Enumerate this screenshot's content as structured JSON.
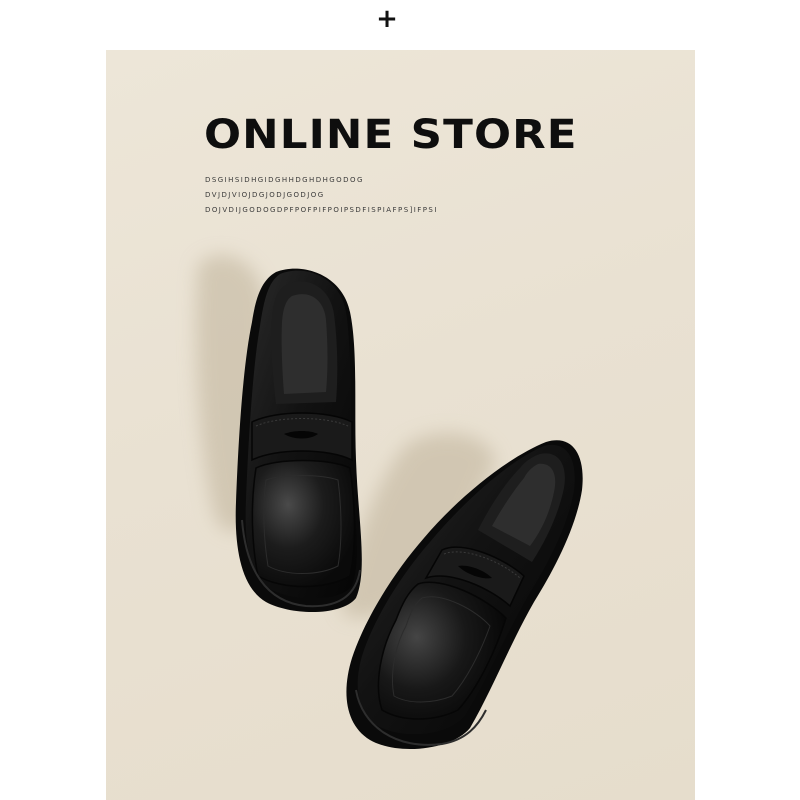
{
  "top_symbol": "+",
  "banner": {
    "headline": "ONLINE STORE",
    "code_lines": [
      "DSGIHSIDHGIDGHHDGHDHGODOG",
      "DVJDJVIOJDGJODJGODJOG",
      "DOJVDIJGODOGDPFPOFPIFPOIPSDFISPIAFPS]IFPSI"
    ]
  },
  "product_image": {
    "subject": "pair of black leather penny loafers",
    "colors": {
      "background": "#e9e1d2",
      "leather": "#111111",
      "shadow": "#cfc3ad"
    }
  }
}
